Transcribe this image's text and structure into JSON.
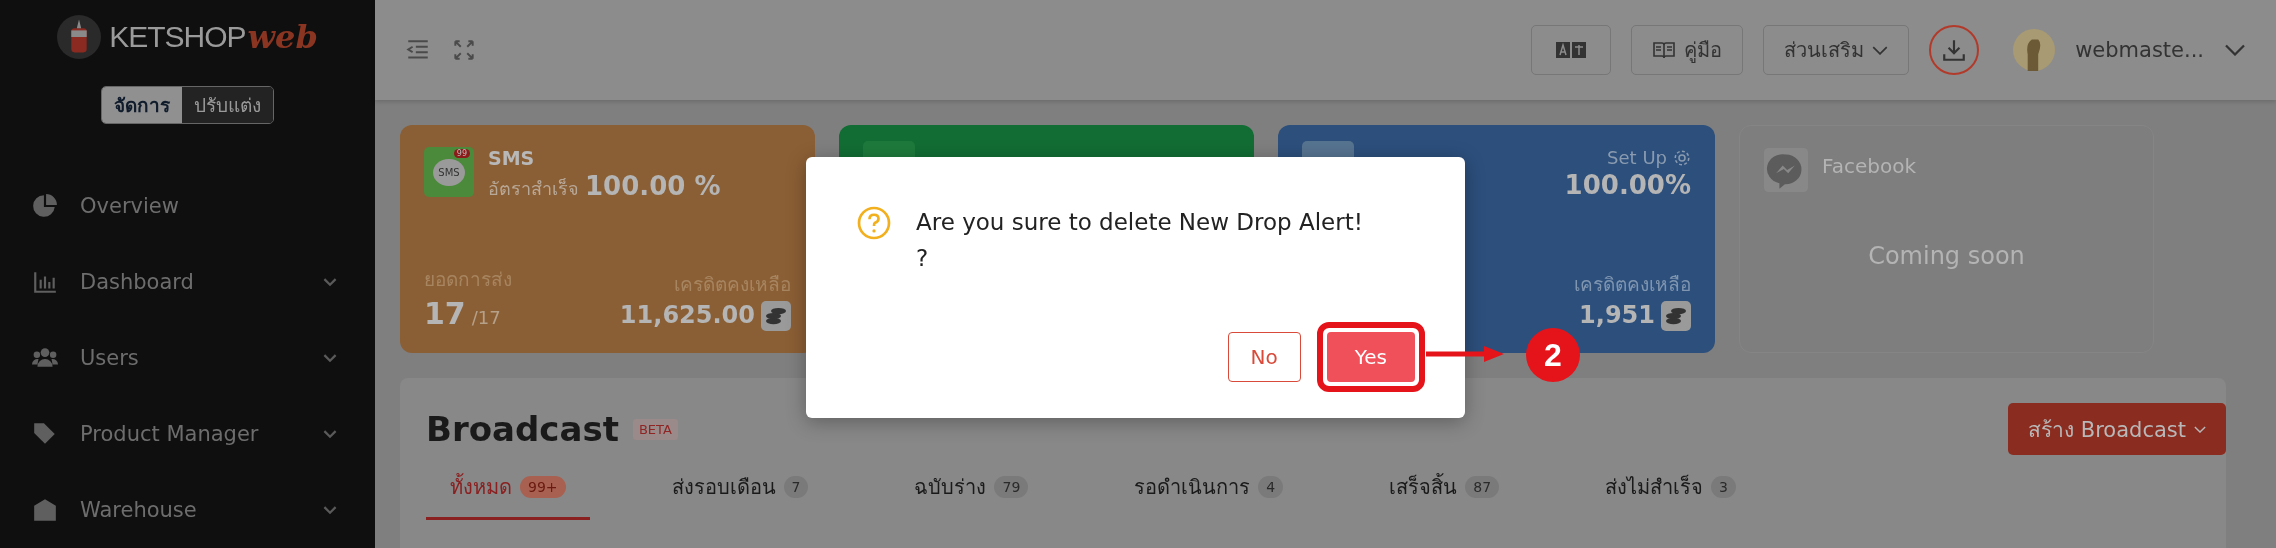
{
  "brand": {
    "name": "KETSHOP",
    "script": "web"
  },
  "mode_toggle": [
    {
      "label": "จัดการ",
      "selected": true
    },
    {
      "label": "ปรับแต่ง",
      "selected": false
    }
  ],
  "sidebar": {
    "items": [
      {
        "label": "Overview",
        "expandable": false
      },
      {
        "label": "Dashboard",
        "expandable": true
      },
      {
        "label": "Users",
        "expandable": true
      },
      {
        "label": "Product Manager",
        "expandable": true
      },
      {
        "label": "Warehouse",
        "expandable": true
      }
    ]
  },
  "topbar": {
    "manual": "คู่มือ",
    "addons": "ส่วนเสริม",
    "user": "webmaste..."
  },
  "cards": [
    {
      "kind": "sms",
      "title": "SMS",
      "icon_text": "SMS",
      "badge": "99",
      "rate_label": "อัตราสำเร็จ",
      "rate": "100.00 %",
      "sent_label": "ยอดการส่ง",
      "sent": "17",
      "sent_total": "/17",
      "credit_label": "เครดิตคงเหลือ",
      "credit": "11,625.00"
    },
    {
      "kind": "line"
    },
    {
      "kind": "email",
      "setup": "Set Up",
      "rate": "100.00%",
      "credit_label": "เครดิตคงเหลือ",
      "credit": "1,951"
    },
    {
      "kind": "facebook",
      "title": "Facebook",
      "status": "Coming soon"
    }
  ],
  "broadcast": {
    "title": "Broadcast",
    "badge": "BETA",
    "create_button": "สร้าง Broadcast",
    "tabs": [
      {
        "label": "ทั้งหมด",
        "count": "99+",
        "selected": true
      },
      {
        "label": "ส่งรอบเดือน",
        "count": "7",
        "selected": false
      },
      {
        "label": "ฉบับร่าง",
        "count": "79",
        "selected": false
      },
      {
        "label": "รอดำเนินการ",
        "count": "4",
        "selected": false
      },
      {
        "label": "เสร็จสิ้น",
        "count": "87",
        "selected": false
      },
      {
        "label": "ส่งไม่สำเร็จ",
        "count": "3",
        "selected": false
      }
    ]
  },
  "dialog": {
    "message": "Are you sure to delete New Drop Alert!\n?",
    "buttons": [
      {
        "label": "No",
        "kind": "cancel",
        "highlighted": false
      },
      {
        "label": "Yes",
        "kind": "confirm",
        "highlighted": true
      }
    ]
  },
  "annotation": {
    "step": "2"
  }
}
